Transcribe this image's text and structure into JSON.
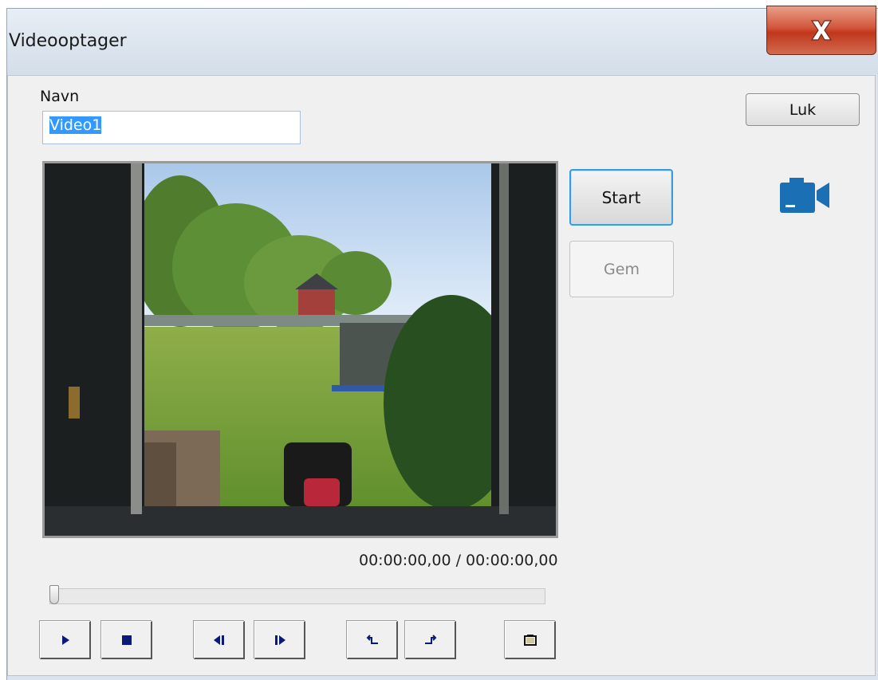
{
  "window": {
    "title": "Videooptager"
  },
  "form": {
    "name_label": "Navn",
    "name_value": "Video1",
    "close_label": "Luk",
    "start_label": "Start",
    "save_label": "Gem"
  },
  "player": {
    "timecode": "00:00:00,00 / 00:00:00,00",
    "seek_position": 0,
    "controls": [
      "play-icon",
      "stop-icon",
      "step-back-icon",
      "step-forward-icon",
      "mark-in-icon",
      "mark-out-icon",
      "snapshot-icon"
    ]
  },
  "colors": {
    "accent": "#1a6fb5",
    "selection": "#3399ff",
    "close_red": "#c0371c",
    "control_icon": "#0b1a7a"
  }
}
